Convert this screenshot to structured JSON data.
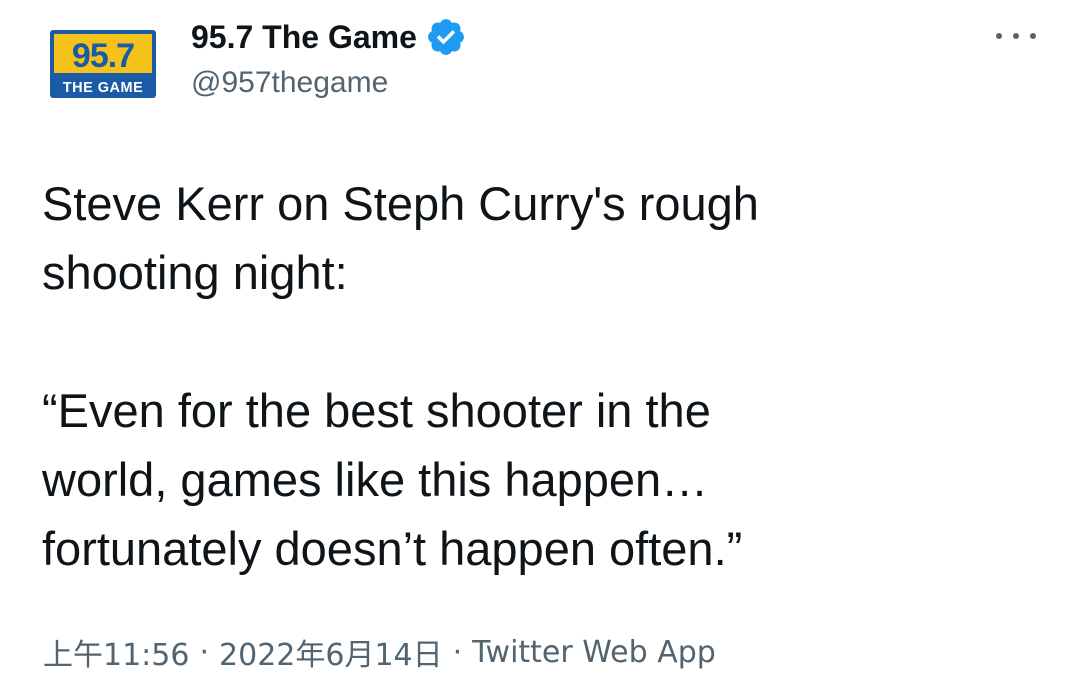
{
  "account": {
    "logo_text_top": "95.7",
    "logo_text_bottom": "THE GAME",
    "display_name": "95.7 The Game",
    "handle": "@957thegame",
    "verified_icon": "verified-badge-icon",
    "more_icon": "more-horizontal-icon"
  },
  "tweet": {
    "lines": [
      "Steve Kerr on Steph Curry's rough",
      "shooting night:",
      "",
      "“Even for the best shooter in the",
      "world, games like this happen…",
      "fortunately doesn’t happen often.”"
    ]
  },
  "meta": {
    "time": "上午11:56",
    "separator": "·",
    "date": "2022年6月14日",
    "source": "Twitter Web App"
  },
  "colors": {
    "text_primary": "#0f1419",
    "text_secondary": "#536471",
    "verified_blue": "#1d9bf0",
    "logo_yellow": "#f4c21a",
    "logo_blue": "#1b5aa6"
  }
}
